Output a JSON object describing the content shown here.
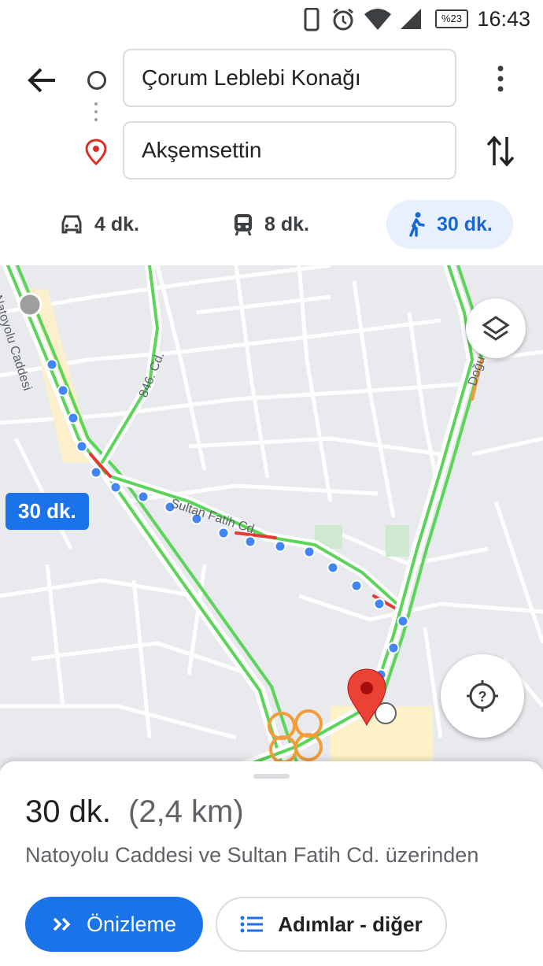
{
  "status_bar": {
    "time": "16:43",
    "battery": "%23"
  },
  "search": {
    "origin": "Çorum Leblebi Konağı",
    "destination": "Akşemsettin"
  },
  "modes": [
    {
      "label": "4 dk.",
      "icon": "car-icon"
    },
    {
      "label": "8 dk.",
      "icon": "transit-icon"
    },
    {
      "label": "30 dk.",
      "icon": "walk-icon",
      "active": true
    }
  ],
  "map": {
    "eta_badge": "30 dk.",
    "street_labels": {
      "natoyolu": "Natoyolu Caddesi",
      "cd846": "846. Cd.",
      "sultan_fatih": "Sultan Fatih Cd.",
      "dogu": "Doğu"
    }
  },
  "sheet": {
    "duration": "30 dk.",
    "distance": "(2,4 km)",
    "via": "Natoyolu Caddesi ve Sultan Fatih Cd. üzerinden",
    "preview_label": "Önizleme",
    "steps_label": "Adımlar - diğer"
  },
  "colors": {
    "accent": "#1a73e8",
    "traffic_green": "#5bd45a",
    "traffic_red": "#e53935",
    "pin_red": "#ea4335"
  }
}
